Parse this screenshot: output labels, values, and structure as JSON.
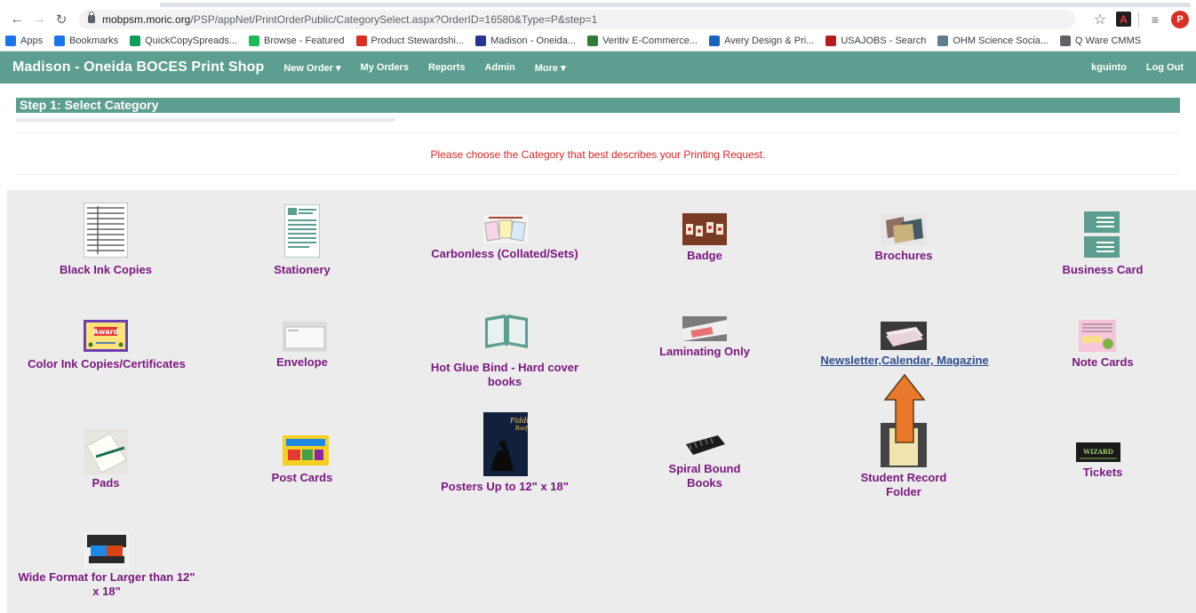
{
  "browser": {
    "url_host": "mobpsm.moric.org",
    "url_path": "/PSP/appNet/PrintOrderPublic/CategorySelect.aspx?OrderID=16580&Type=P&step=1",
    "avatar_letter": "P",
    "pdf_icon_letter": "A",
    "bookmarks": [
      {
        "label": "Apps",
        "icon": "apps-grid-icon",
        "color": "#1a73e8"
      },
      {
        "label": "Bookmarks",
        "icon": "star-icon",
        "color": "#1a73e8"
      },
      {
        "label": "QuickCopySpreads...",
        "icon": "plus-box-icon",
        "color": "#0f9d58"
      },
      {
        "label": "Browse - Featured",
        "icon": "spotify-icon",
        "color": "#1db954"
      },
      {
        "label": "Product Stewardshi...",
        "icon": "logo-icon",
        "color": "#d93025"
      },
      {
        "label": "Madison - Oneida...",
        "icon": "p-icon",
        "color": "#283593"
      },
      {
        "label": "Veritiv E-Commerce...",
        "icon": "v-icon",
        "color": "#2e7d32"
      },
      {
        "label": "Avery Design & Pri...",
        "icon": "avery-icon",
        "color": "#1565c0"
      },
      {
        "label": "USAJOBS - Search",
        "icon": "eagle-icon",
        "color": "#b71c1c"
      },
      {
        "label": "OHM Science Socia...",
        "icon": "ohm-icon",
        "color": "#607d8b"
      },
      {
        "label": "Q Ware CMMS",
        "icon": "globe-icon",
        "color": "#5f6368"
      }
    ]
  },
  "nav": {
    "brand": "Madison - Oneida BOCES Print Shop",
    "new_order": "New Order ▾",
    "my_orders": "My Orders",
    "reports": "Reports",
    "admin": "Admin",
    "more": "More ▾",
    "user": "kguinto",
    "logout": "Log Out"
  },
  "page": {
    "step_title": "Step 1: Select Category",
    "prompt": "Please choose the Category that best describes your Printing Request."
  },
  "categories": [
    {
      "label": "Black Ink Copies"
    },
    {
      "label": "Stationery"
    },
    {
      "label": "Carbonless (Collated/Sets)"
    },
    {
      "label": "Badge"
    },
    {
      "label": "Brochures"
    },
    {
      "label": "Business Card"
    },
    {
      "label": "Color Ink Copies/Certificates"
    },
    {
      "label": "Envelope"
    },
    {
      "label": "Hot Glue Bind - Hard cover books"
    },
    {
      "label": "Laminating Only"
    },
    {
      "label": "Newsletter,Calendar, Magazine"
    },
    {
      "label": "Note Cards"
    },
    {
      "label": "Pads"
    },
    {
      "label": "Post Cards"
    },
    {
      "label": "Posters Up to 12\" x 18\""
    },
    {
      "label": "Spiral Bound Books"
    },
    {
      "label": "Student Record Folder"
    },
    {
      "label": "Tickets"
    },
    {
      "label": "Wide Format for Larger than 12\" x 18\""
    }
  ],
  "colors": {
    "theme": "#5c9e8f",
    "category_text": "#7b1880",
    "link_text": "#2b4d8f",
    "prompt": "#e02424",
    "arrow": "#e8792b"
  }
}
